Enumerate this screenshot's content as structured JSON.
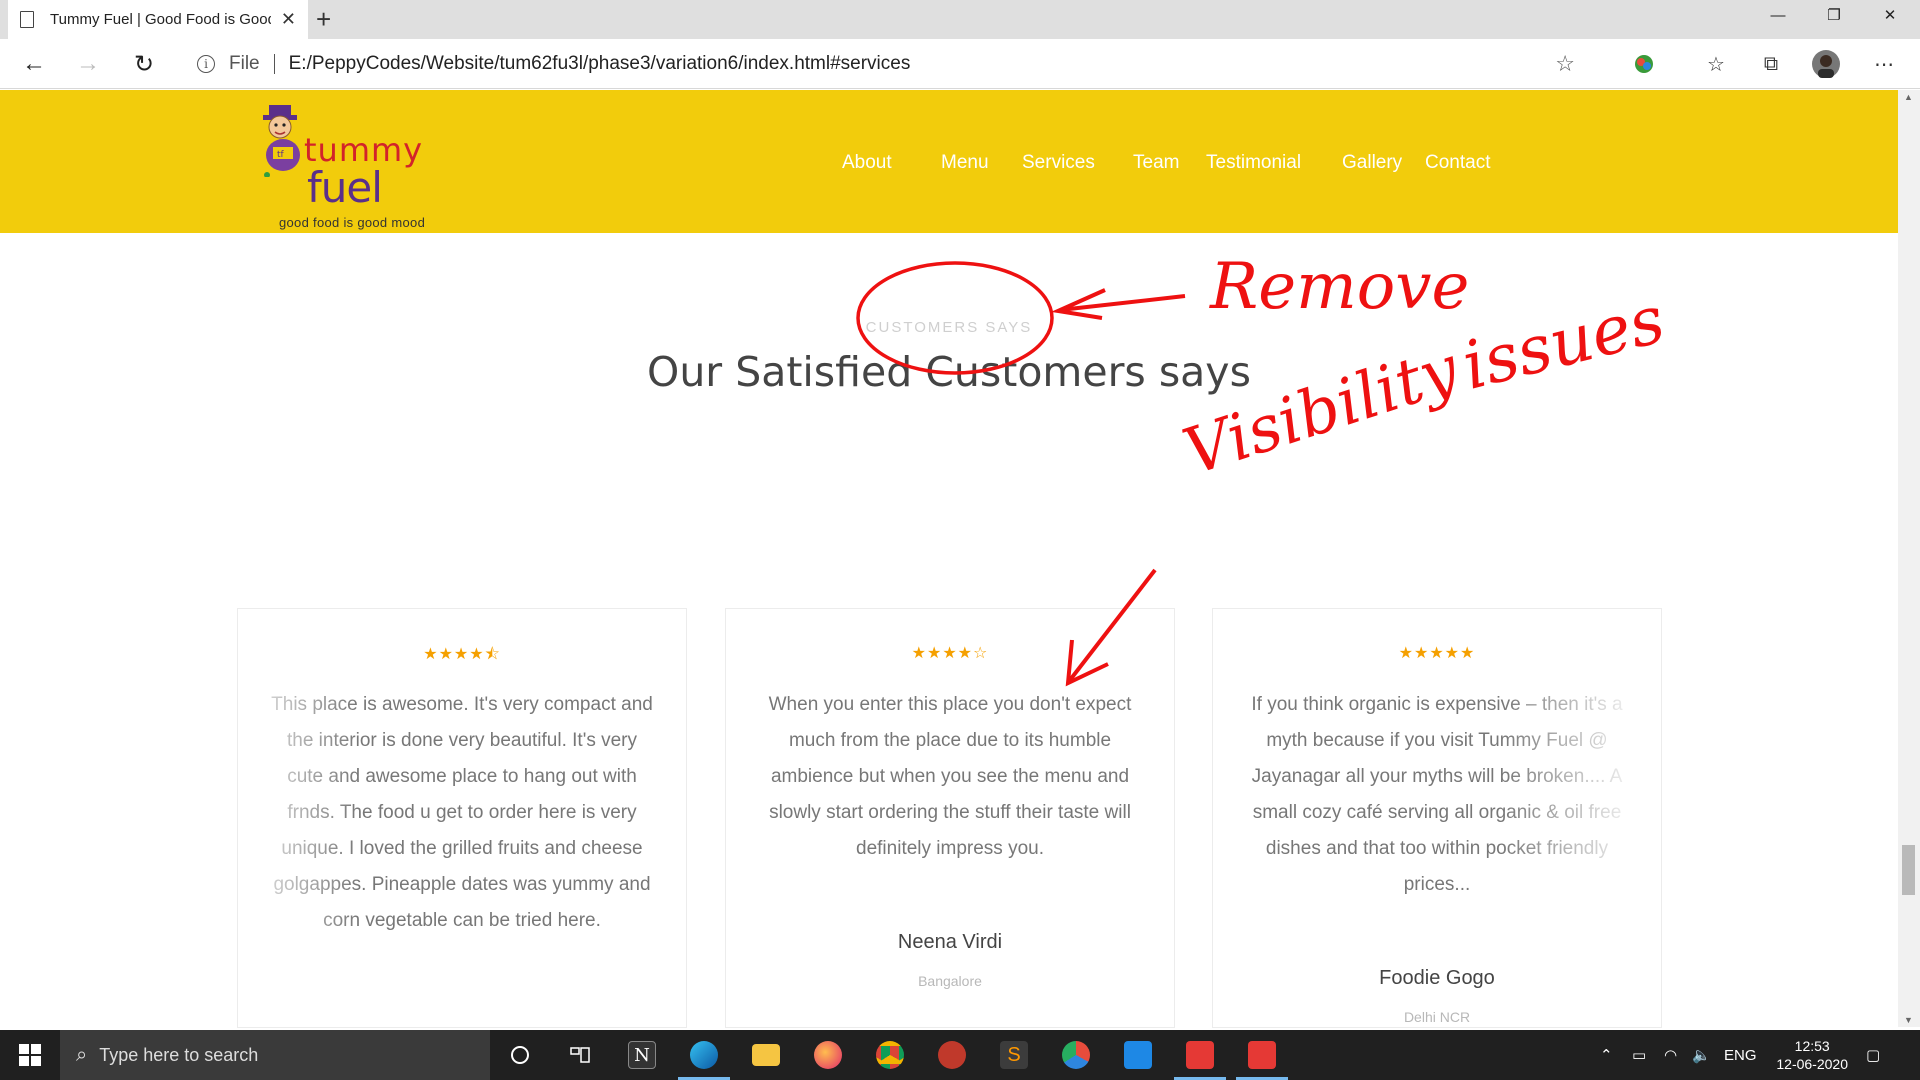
{
  "browser": {
    "tab_title": "Tummy Fuel | Good Food is Good Mood",
    "new_tab": "+",
    "scheme_label": "File",
    "url": "E:/PeppyCodes/Website/tum62fu3l/phase3/variation6/index.html#services"
  },
  "site": {
    "logo": {
      "word1": "tummy",
      "word2": "fuel",
      "tagline": "good food is good mood"
    },
    "nav": [
      "About",
      "Menu",
      "Services",
      "Team",
      "Testimonial",
      "Gallery",
      "Contact"
    ]
  },
  "section": {
    "subtitle": "CUSTOMERS SAYS",
    "heading": "Our Satisfied Customers says"
  },
  "testimonials": [
    {
      "stars": "★★★★⯪",
      "rating": 4.5,
      "text": "This place is awesome. It's very compact and the interior is done very beautiful. It's very cute and awesome place to hang out with frnds. The food u get to order here is very unique. I loved the grilled fruits and cheese golgappes. Pineapple dates was yummy and corn vegetable can be tried here.",
      "name": "",
      "location": ""
    },
    {
      "stars": "★★★★☆",
      "rating": 4,
      "text": "When you enter this place you don't expect much from the place due to its humble ambience but when you see the menu and slowly start ordering the stuff their taste will definitely impress you.",
      "name": "Neena Virdi",
      "location": "Bangalore"
    },
    {
      "stars": "★★★★★",
      "rating": 5,
      "text": "If you think organic is expensive – then it's a myth because if you visit Tummy Fuel @ Jayanagar all your myths will be broken.... A small cozy café serving all organic & oil free dishes and that too within pocket friendly prices...",
      "name": "Foodie Gogo",
      "location": "Delhi NCR"
    }
  ],
  "annotations": {
    "remove": "Remove",
    "visibility": "Visibility",
    "issues": "issues",
    "color": "#e11"
  },
  "taskbar": {
    "search_placeholder": "Type here to search",
    "language": "ENG",
    "time": "12:53",
    "date": "12-06-2020"
  }
}
